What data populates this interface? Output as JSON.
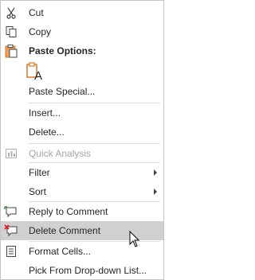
{
  "menu": {
    "items": [
      {
        "key": "cut",
        "label": "Cut",
        "icon": "scissors-icon"
      },
      {
        "key": "copy",
        "label": "Copy",
        "icon": "copy-icon"
      },
      {
        "key": "paste_special",
        "label": "Paste Special..."
      },
      {
        "key": "insert",
        "label": "Insert..."
      },
      {
        "key": "delete",
        "label": "Delete..."
      },
      {
        "key": "quick_analysis",
        "label": "Quick Analysis",
        "icon": "quick-analysis-icon",
        "disabled": true
      },
      {
        "key": "filter",
        "label": "Filter",
        "submenu": true
      },
      {
        "key": "sort",
        "label": "Sort",
        "submenu": true
      },
      {
        "key": "reply_to_comment",
        "label": "Reply to Comment",
        "icon": "reply-comment-icon"
      },
      {
        "key": "delete_comment",
        "label": "Delete Comment",
        "icon": "delete-comment-icon",
        "hovered": true
      },
      {
        "key": "format_cells",
        "label": "Format Cells...",
        "icon": "format-cells-icon"
      },
      {
        "key": "pick_from_dropdown",
        "label": "Pick From Drop-down List..."
      }
    ],
    "paste_options": {
      "label": "Paste Options:",
      "icon": "paste-icon",
      "buttons": [
        {
          "icon": "paste-keep-text-only-icon",
          "glyph": "A"
        }
      ]
    }
  },
  "colors": {
    "hover_background": "#d0d0d0",
    "disabled_text": "#a6a6a6",
    "border": "#c6c6c6",
    "delete_x": "#e81123",
    "paste_orange": "#d87a26"
  }
}
